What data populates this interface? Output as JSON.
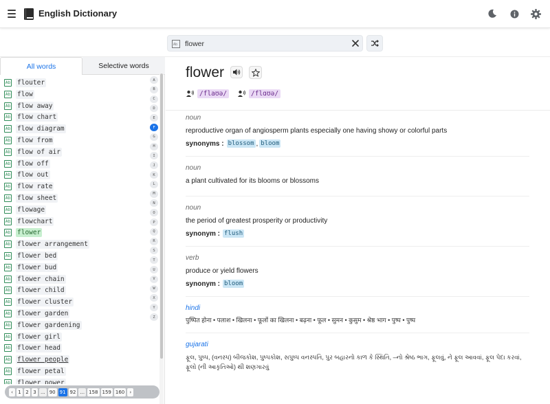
{
  "header": {
    "title": "English Dictionary",
    "icons": {
      "menu": "hamburger-menu-icon",
      "logo": "book-icon",
      "theme": "moon-icon",
      "info": "info-icon",
      "settings": "gear-icon"
    }
  },
  "search": {
    "value": "flower",
    "placeholder": "",
    "icon": "dictionary-icon",
    "clear_icon": "close-icon",
    "shuffle_icon": "shuffle-icon"
  },
  "tabs": [
    {
      "label": "All words",
      "active": true
    },
    {
      "label": "Selective words",
      "active": false
    }
  ],
  "word_list": [
    "flouter",
    "flow",
    "flow away",
    "flow chart",
    "flow diagram",
    "flow from",
    "flow of air",
    "flow off",
    "flow out",
    "flow rate",
    "flow sheet",
    "flowage",
    "flowchart",
    "flower",
    "flower arrangement",
    "flower bed",
    "flower bud",
    "flower chain",
    "flower child",
    "flower cluster",
    "flower garden",
    "flower gardening",
    "flower girl",
    "flower head",
    "flower people",
    "flower petal",
    "flower power"
  ],
  "selected_word": "flower",
  "hovered_word": "flower people",
  "alphabet": [
    "A",
    "B",
    "C",
    "D",
    "E",
    "F",
    "G",
    "H",
    "I",
    "J",
    "K",
    "L",
    "M",
    "N",
    "O",
    "P",
    "Q",
    "R",
    "S",
    "T",
    "U",
    "V",
    "W",
    "X",
    "Y",
    "Z"
  ],
  "active_letter": "F",
  "pagination": [
    "‹",
    "1",
    "2",
    "3",
    "...",
    "90",
    "91",
    "92",
    "...",
    "158",
    "159",
    "160",
    "›"
  ],
  "active_page": "91",
  "entry": {
    "word": "flower",
    "pronunciations": [
      {
        "icon": "speaker-person-icon",
        "text": "/flaʊə/"
      },
      {
        "icon": "speaker-person-icon",
        "text": "/flɑʊə/"
      }
    ],
    "senses": [
      {
        "pos": "noun",
        "definition": "reproductive organ of angiosperm plants especially one having showy or colorful parts",
        "syn_label": "synonyms :",
        "synonyms": [
          "blossom",
          "bloom"
        ]
      },
      {
        "pos": "noun",
        "definition": "a plant cultivated for its blooms or blossoms",
        "syn_label": "",
        "synonyms": []
      },
      {
        "pos": "noun",
        "definition": "the period of greatest prosperity or productivity",
        "syn_label": "synonym :",
        "synonyms": [
          "flush"
        ]
      },
      {
        "pos": "verb",
        "definition": "produce or yield flowers",
        "syn_label": "synonym :",
        "synonyms": [
          "bloom"
        ]
      }
    ],
    "translations": [
      {
        "language": "hindi",
        "text": "पुष्पित होना • पलाश • खिलना • फूलों का खिलना • बढ़ना • फूल • सुमन • कुसुम • श्रेष्ठ भाग • पुष्प • पुष्प"
      },
      {
        "language": "gujarati",
        "text": "ફૂલ, પુષ્પ, (વનસ્પ) બીજકોશ, પુષ્પકોશ, સપુષ્પ વનસ્પતિ, પુર બહારનો કાળ કે સ્થિતિ, –નો શ્રેષ્ઠ ભાગ, ફૂલવું, ને ફૂલ આવવાં, ફૂલ પેદા કરવાં, ફૂલો (ની આકૃતિઓ) થી શણગારવું"
      }
    ]
  }
}
